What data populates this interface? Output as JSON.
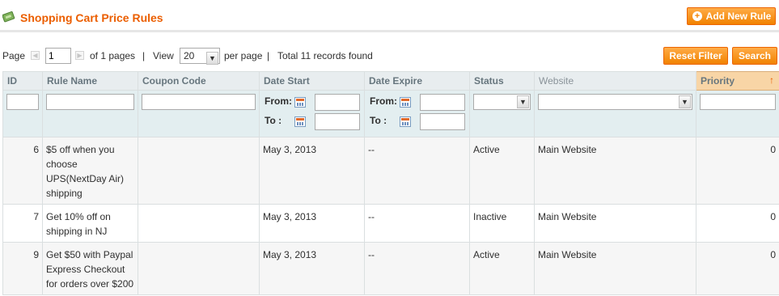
{
  "header": {
    "title": "Shopping Cart Price Rules",
    "add_button": "Add New Rule"
  },
  "pager": {
    "page_label": "Page",
    "current_page": "1",
    "of_pages": "of 1 pages",
    "view_label": "View",
    "per_page_value": "20",
    "per_page_label": "per page",
    "total": "Total 11 records found",
    "separator": "|"
  },
  "actions": {
    "reset_filter": "Reset Filter",
    "search": "Search"
  },
  "columns": {
    "id": "ID",
    "rule_name": "Rule Name",
    "coupon_code": "Coupon Code",
    "date_start": "Date Start",
    "date_expire": "Date Expire",
    "status": "Status",
    "website": "Website",
    "priority": "Priority"
  },
  "filter": {
    "from_label": "From:",
    "to_label": "To :"
  },
  "rows": [
    {
      "id": "6",
      "name": "$5 off when you choose UPS(NextDay Air) shipping",
      "coupon": "",
      "start": "May 3, 2013",
      "expire": "--",
      "status": "Active",
      "website": "Main Website",
      "priority": "0"
    },
    {
      "id": "7",
      "name": "Get 10% off on shipping in NJ",
      "coupon": "",
      "start": "May 3, 2013",
      "expire": "--",
      "status": "Inactive",
      "website": "Main Website",
      "priority": "0"
    },
    {
      "id": "9",
      "name": "Get $50 with Paypal Express Checkout for orders over $200",
      "coupon": "",
      "start": "May 3, 2013",
      "expire": "--",
      "status": "Active",
      "website": "Main Website",
      "priority": "0"
    }
  ],
  "colors": {
    "accent": "#eb5e00",
    "button": "#f18200",
    "header_bg": "#e8edef",
    "filter_bg": "#e3eef0",
    "sorted_bg": "#f8d5a6"
  },
  "icons": {
    "header": "price-rule-icon",
    "add": "plus-circle-icon",
    "calendar": "calendar-icon",
    "sort": "sort-arrow-up-icon"
  }
}
